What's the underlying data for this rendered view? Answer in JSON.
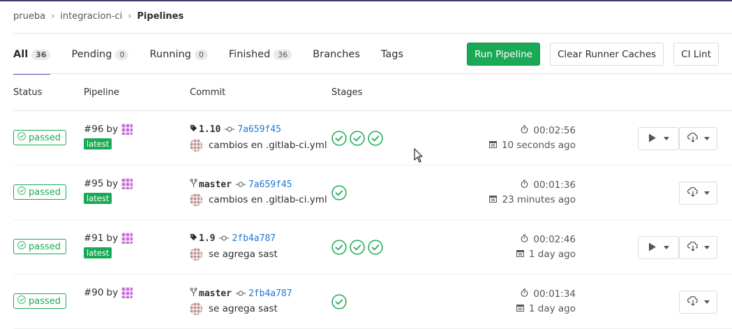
{
  "breadcrumb": {
    "items": [
      "prueba",
      "integracion-ci"
    ],
    "current": "Pipelines"
  },
  "tabs": [
    {
      "label": "All",
      "count": "36"
    },
    {
      "label": "Pending",
      "count": "0"
    },
    {
      "label": "Running",
      "count": "0"
    },
    {
      "label": "Finished",
      "count": "36"
    },
    {
      "label": "Branches"
    },
    {
      "label": "Tags"
    }
  ],
  "actions": {
    "run": "Run Pipeline",
    "clear": "Clear Runner Caches",
    "lint": "CI Lint"
  },
  "columns": {
    "status": "Status",
    "pipeline": "Pipeline",
    "commit": "Commit",
    "stages": "Stages"
  },
  "rows": [
    {
      "status": "passed",
      "id": "#96",
      "by": "by",
      "latest": "latest",
      "ref_type": "tag",
      "ref": "1.10",
      "sha": "7a659f45",
      "message": "cambios en .gitlab-ci.yml",
      "stages": 3,
      "duration": "00:02:56",
      "finished": "10 seconds ago",
      "has_play": true
    },
    {
      "status": "passed",
      "id": "#95",
      "by": "by",
      "latest": "latest",
      "ref_type": "branch",
      "ref": "master",
      "sha": "7a659f45",
      "message": "cambios en .gitlab-ci.yml",
      "stages": 1,
      "duration": "00:01:36",
      "finished": "23 minutes ago",
      "has_play": false
    },
    {
      "status": "passed",
      "id": "#91",
      "by": "by",
      "latest": "latest",
      "ref_type": "tag",
      "ref": "1.9",
      "sha": "2fb4a787",
      "message": "se agrega sast",
      "stages": 3,
      "duration": "00:02:46",
      "finished": "1 day ago",
      "has_play": true
    },
    {
      "status": "passed",
      "id": "#90",
      "by": "by",
      "latest": "",
      "ref_type": "branch",
      "ref": "master",
      "sha": "2fb4a787",
      "message": "se agrega sast",
      "stages": 1,
      "duration": "00:01:34",
      "finished": "1 day ago",
      "has_play": false
    }
  ],
  "colors": {
    "success": "#1aaa55",
    "link": "#1f78d1",
    "active_tab": "#6b4fbb"
  }
}
